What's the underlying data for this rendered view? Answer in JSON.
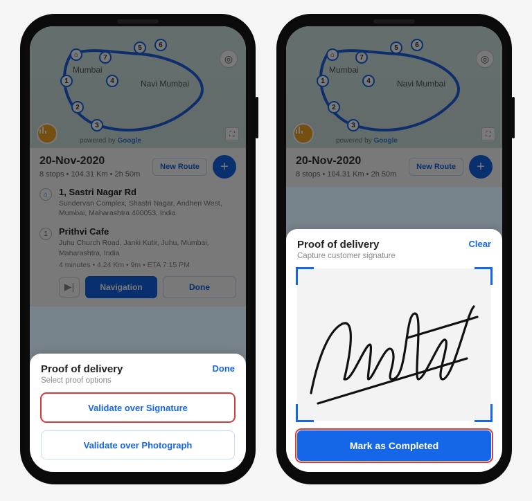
{
  "left": {
    "date": "20-Nov-2020",
    "summary": "8 stops • 104.31 Km • 2h 50m",
    "new_route": "New Route",
    "stops": [
      {
        "pin": "home",
        "title": "1, Sastri Nagar Rd",
        "addr": "Sundervan Complex, Shastri Nagar, Andheri West, Mumbai, Maharashtra 400053, India"
      },
      {
        "pin": "1",
        "title": "Prithvi Cafe",
        "addr": "Juhu Church Road, Janki Kutir, Juhu, Mumbai, Maharashtra, India",
        "meta": "4 minutes • 4.24 Km • 9m • ETA 7:15 PM"
      }
    ],
    "nav_btn": "Navigation",
    "done_btn": "Done",
    "sheet": {
      "title": "Proof of delivery",
      "subtitle": "Select proof options",
      "action": "Done",
      "opt_sig": "Validate over Signature",
      "opt_photo": "Validate over Photograph"
    }
  },
  "right": {
    "date": "20-Nov-2020",
    "summary": "8 stops • 104.31 Km • 2h 50m",
    "new_route": "New Route",
    "sheet": {
      "title": "Proof of delivery",
      "subtitle": "Capture customer signature",
      "action": "Clear",
      "mark_btn": "Mark as Completed"
    }
  },
  "map": {
    "city1": "Mumbai",
    "city2": "Navi Mumbai",
    "credit_pre": "powered by ",
    "credit_brand": "Google",
    "waypoints": [
      "1",
      "2",
      "3",
      "4",
      "5",
      "6",
      "7"
    ]
  }
}
